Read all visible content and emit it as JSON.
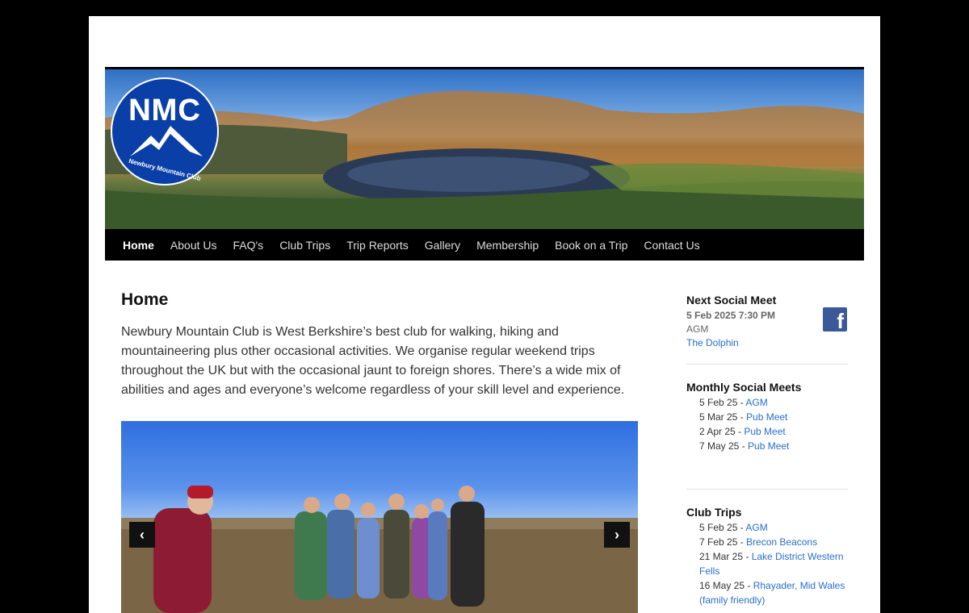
{
  "logo": {
    "text": "NMC",
    "ring_text": "Newbury Mountain Club"
  },
  "nav": {
    "items": [
      {
        "label": "Home"
      },
      {
        "label": "About Us"
      },
      {
        "label": "FAQ's"
      },
      {
        "label": "Club Trips"
      },
      {
        "label": "Trip Reports"
      },
      {
        "label": "Gallery"
      },
      {
        "label": "Membership"
      },
      {
        "label": "Book on a Trip"
      },
      {
        "label": "Contact Us"
      }
    ]
  },
  "main": {
    "title": "Home",
    "intro": "Newbury Mountain Club is West Berkshire’s best club for walking, hiking and mountaineering plus other occasional activities. We organise regular weekend trips throughout the UK but with the occasional jaunt to foreign shores. There’s a wide mix of abilities and ages and everyone’s welcome regardless of your skill level and experience."
  },
  "slider": {
    "prev": "‹",
    "next": "›"
  },
  "sidebar": {
    "next_social": {
      "title": "Next Social Meet",
      "date": "5 Feb 2025 7:30 PM",
      "event": "AGM",
      "venue": "The Dolphin"
    },
    "monthly": {
      "title": "Monthly Social Meets",
      "items": [
        {
          "date": "5 Feb 25",
          "name": "AGM"
        },
        {
          "date": "5 Mar 25",
          "name": "Pub Meet"
        },
        {
          "date": "2 Apr 25",
          "name": "Pub Meet"
        },
        {
          "date": "7 May 25",
          "name": "Pub Meet"
        }
      ]
    },
    "trips": {
      "title": "Club Trips",
      "items": [
        {
          "date": "5 Feb 25",
          "name": "AGM"
        },
        {
          "date": "7 Feb 25",
          "name": "Brecon Beacons"
        },
        {
          "date": "21 Mar 25",
          "name": "Lake District Western Fells"
        },
        {
          "date": "16 May 25",
          "name": "Rhayader, Mid Wales (family friendly)"
        }
      ]
    },
    "sep": " - "
  },
  "colors": {
    "link": "#2a6ecc",
    "nav_bg": "#000000",
    "logo_blue": "#0a3fa8",
    "facebook": "#3b5998"
  }
}
